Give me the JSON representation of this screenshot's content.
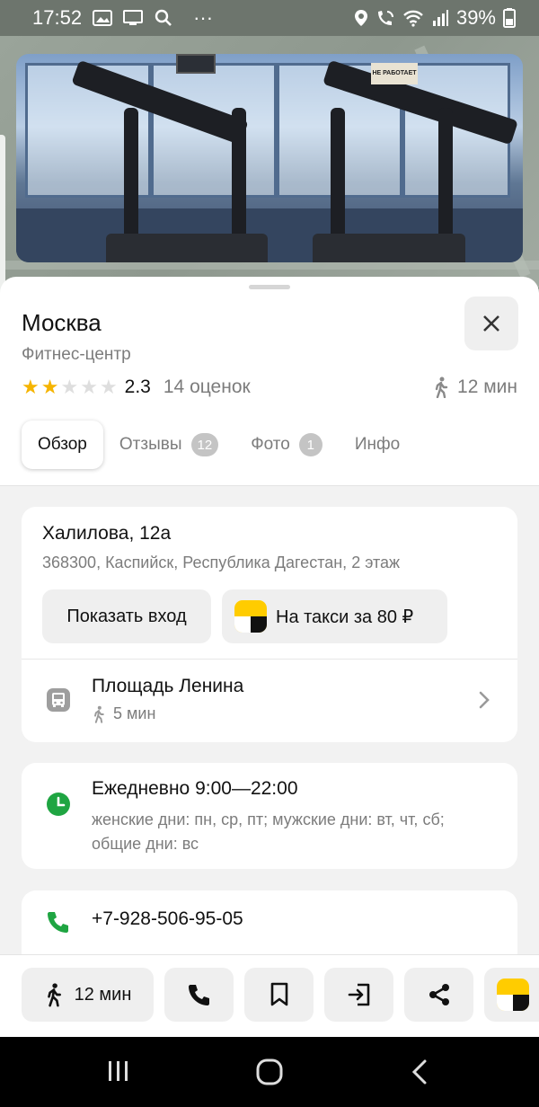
{
  "status_bar": {
    "time": "17:52",
    "more": "···",
    "battery": "39%",
    "icons": [
      "gallery-icon",
      "screen-icon",
      "search-icon",
      "location-icon",
      "wifi-call-icon",
      "wifi-icon",
      "signal-icon",
      "battery-icon"
    ]
  },
  "photo": {
    "sign_text": "НЕ РАБОТАЕТ"
  },
  "place": {
    "title": "Москва",
    "category": "Фитнес-центр",
    "rating_value": "2.3",
    "rating_stars": 2,
    "rating_count": "14 оценок",
    "walk_time": "12 мин"
  },
  "tabs": [
    {
      "label": "Обзор",
      "active": true
    },
    {
      "label": "Отзывы",
      "badge": "12"
    },
    {
      "label": "Фото",
      "badge": "1"
    },
    {
      "label": "Инфо"
    }
  ],
  "address": {
    "street": "Халилова, 12а",
    "full": "368300, Каспийск, Республика Дагестан, 2 этаж",
    "show_entrance_label": "Показать вход",
    "taxi_label": "На такси за 80 ₽"
  },
  "transit": {
    "stop_name": "Площадь Ленина",
    "walk_time": "5 мин"
  },
  "hours": {
    "main": "Ежедневно 9:00—22:00",
    "note": "женские дни: пн, ср, пт; мужские дни: вт, чт, сб; общие дни: вс"
  },
  "contact": {
    "phone": "+7-928-506-95-05"
  },
  "action_bar": {
    "route_label": "12 мин"
  },
  "colors": {
    "star": "#f5b400",
    "accent_green": "#1fa542",
    "taxi_yellow": "#ffcc00"
  }
}
